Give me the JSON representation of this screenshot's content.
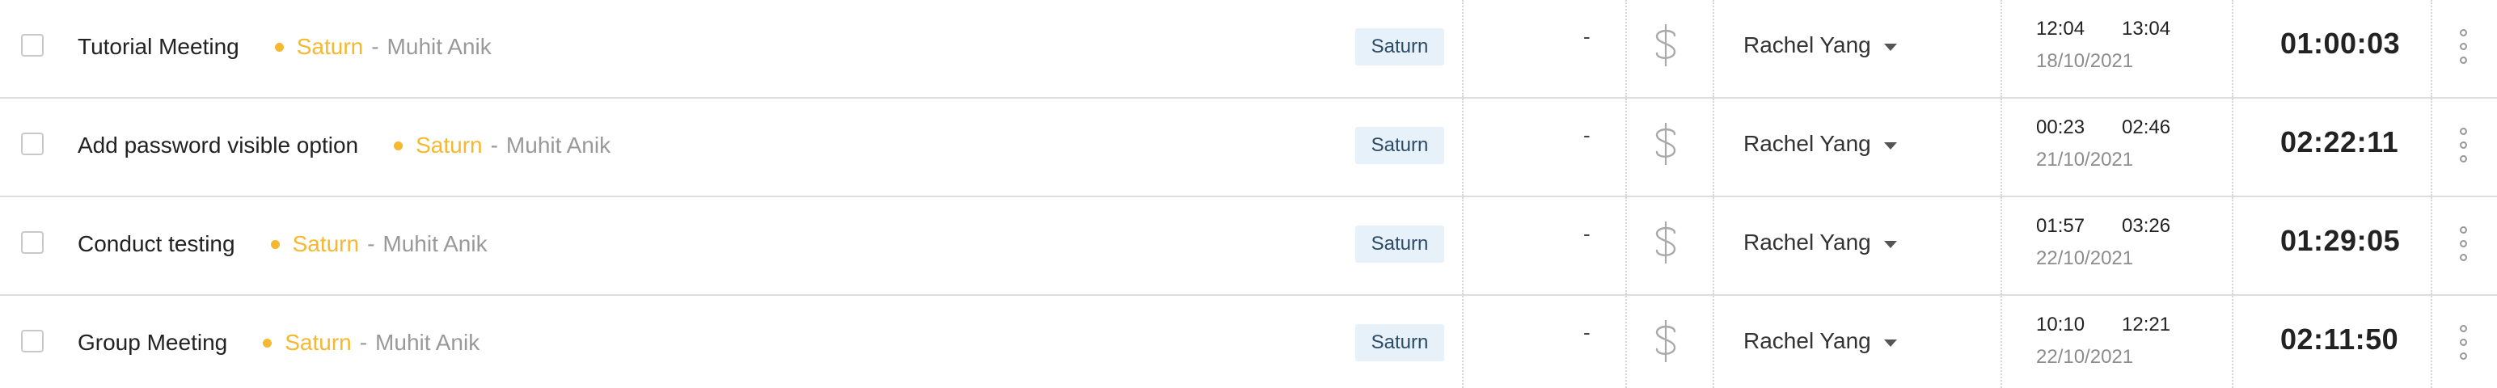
{
  "colors": {
    "project_accent": "#F5B82E",
    "tag_background": "#E6F1FA",
    "tag_text": "#2C4B67",
    "muted_text": "#999999"
  },
  "icons": {
    "billable": "dollar-icon",
    "dropdown": "caret-down-icon",
    "more": "more-vertical-icon"
  },
  "entries": [
    {
      "title": "Tutorial Meeting",
      "project": "Saturn",
      "separator": "-",
      "client": "Muhit Anik",
      "tag": "Saturn",
      "rate": "-",
      "user": "Rachel Yang",
      "start": "12:04",
      "end": "13:04",
      "date": "18/10/2021",
      "duration": "01:00:03"
    },
    {
      "title": "Add password visible option",
      "project": "Saturn",
      "separator": "-",
      "client": "Muhit Anik",
      "tag": "Saturn",
      "rate": "-",
      "user": "Rachel Yang",
      "start": "00:23",
      "end": "02:46",
      "date": "21/10/2021",
      "duration": "02:22:11"
    },
    {
      "title": "Conduct testing",
      "project": "Saturn",
      "separator": "-",
      "client": "Muhit Anik",
      "tag": "Saturn",
      "rate": "-",
      "user": "Rachel Yang",
      "start": "01:57",
      "end": "03:26",
      "date": "22/10/2021",
      "duration": "01:29:05"
    },
    {
      "title": "Group Meeting",
      "project": "Saturn",
      "separator": "-",
      "client": "Muhit Anik",
      "tag": "Saturn",
      "rate": "-",
      "user": "Rachel Yang",
      "start": "10:10",
      "end": "12:21",
      "date": "22/10/2021",
      "duration": "02:11:50"
    }
  ]
}
